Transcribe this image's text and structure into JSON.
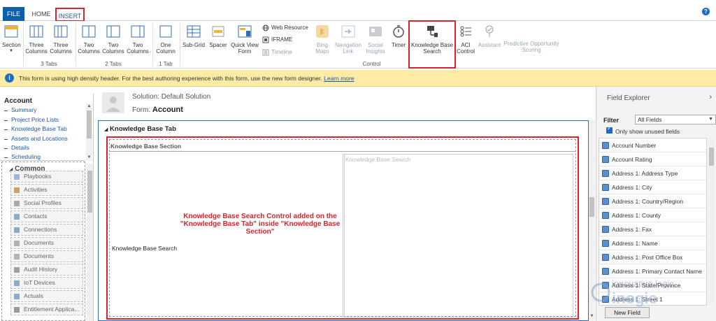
{
  "tabs": [
    {
      "label": "FILE"
    },
    {
      "label": "HOME"
    },
    {
      "label": "INSERT"
    }
  ],
  "help_icon": "?",
  "ribbon": {
    "section": {
      "label": "Section"
    },
    "three_col_a": {
      "label": "Three Columns"
    },
    "three_col_b": {
      "label": "Three Columns"
    },
    "two_col_a": {
      "label": "Two Columns"
    },
    "two_col_b": {
      "label": "Two Columns"
    },
    "two_col_c": {
      "label": "Two Columns"
    },
    "one_col": {
      "label": "One Column"
    },
    "subgrid": {
      "label": "Sub-Grid"
    },
    "spacer": {
      "label": "Spacer"
    },
    "quick_view": {
      "label": "Quick View Form"
    },
    "web_resource": {
      "label": "Web Resource"
    },
    "iframe": {
      "label": "IFRAME"
    },
    "timeline": {
      "label": "Timeline"
    },
    "bing_maps": {
      "label": "Bing Maps"
    },
    "navigation_link": {
      "label": "Navigation Link"
    },
    "social_insights": {
      "label": "Social Insights"
    },
    "timer": {
      "label": "Timer"
    },
    "kb_search": {
      "label": "Knowledge Base Search"
    },
    "aci_control": {
      "label": "ACI Control"
    },
    "assistant": {
      "label": "Assistant"
    },
    "predictive": {
      "label": "Predictive Opportunity Scoring"
    },
    "groups": {
      "three_tabs": "3 Tabs",
      "two_tabs": "2 Tabs",
      "one_tab": "1 Tab",
      "control": "Control"
    }
  },
  "infobar": {
    "text": "This form is using high density header. For the best authoring experience with this form, use the new form designer.",
    "link": "Learn more"
  },
  "leftnav": {
    "account_title": "Account",
    "account_links": [
      "Summary",
      "Project Price Lists",
      "Knowledge Base Tab",
      "Assets and Locations",
      "Details",
      "Scheduling"
    ],
    "common_title": "Common",
    "common_items": [
      "Playbooks",
      "Activities",
      "Social Profiles",
      "Contacts",
      "Connections",
      "Documents",
      "Documents",
      "Audit History",
      "IoT Devices",
      "Actuals",
      "Entitlement Applica..."
    ]
  },
  "form_header": {
    "solution": "Solution: Default Solution",
    "form_prefix": "Form:",
    "form_name": "Account"
  },
  "canvas": {
    "tab_title": "Knowledge Base Tab",
    "section_title": "Knowledge Base Section",
    "field_label": "Knowledge Base Search",
    "kb_control_label": "Knowledge Base Search",
    "annotation": "Knowledge Base Search Control added on the \"Knowledge Base Tab\" inside \"Knowledge Base Section\""
  },
  "field_explorer": {
    "title": "Field Explorer",
    "filter_label": "Filter",
    "filter_value": "All Fields",
    "only_unused_label": "Only show unused fields",
    "only_unused_checked": true,
    "fields": [
      "Account Number",
      "Account Rating",
      "Address 1: Address Type",
      "Address 1: City",
      "Address 1: Country/Region",
      "Address 1: County",
      "Address 1: Fax",
      "Address 1: Name",
      "Address 1: Post Office Box",
      "Address 1: Primary Contact Name",
      "Address 1: State/Province",
      "Address 1: Street 1"
    ],
    "new_field_label": "New Field"
  },
  "watermark": {
    "line1": "innovative logic",
    "line2": "inogic"
  },
  "colors": {
    "accent_blue": "#0f5fa8",
    "highlight_red": "#d9232b",
    "info_yellow": "#fdeba6",
    "link_blue": "#1a57a8"
  }
}
